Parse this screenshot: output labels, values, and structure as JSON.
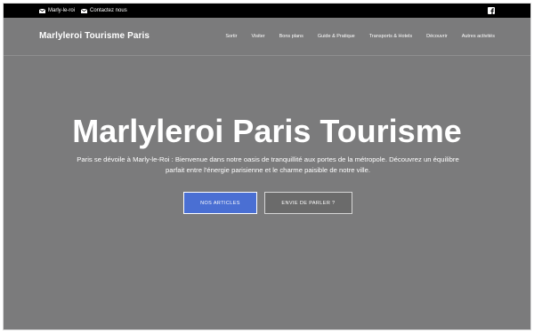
{
  "topbar": {
    "contacts": [
      {
        "label": "Marly-le-roi",
        "icon": "envelope-icon"
      },
      {
        "label": "Contactez nous",
        "icon": "envelope-icon"
      }
    ],
    "social_icon": "facebook-icon"
  },
  "navbar": {
    "brand": "Marlyleroi Tourisme Paris",
    "items": [
      {
        "label": "Sortir"
      },
      {
        "label": "Visiter"
      },
      {
        "label": "Bons plans"
      },
      {
        "label": "Guide & Pratique"
      },
      {
        "label": "Transports & Hotels"
      },
      {
        "label": "Découvrir"
      },
      {
        "label": "Autres activités"
      }
    ]
  },
  "hero": {
    "title": "Marlyleroi Paris Tourisme",
    "lead": "Paris se dévoile à Marly-le-Roi : Bienvenue dans notre oasis de tranquillité aux portes de la métropole. Découvrez un équilibre parfait entre l'énergie parisienne et le charme paisible de notre ville.",
    "primary_button": "NOS ARTICLES",
    "secondary_button": "ENVIE DE PARLER ?"
  },
  "colors": {
    "topbar": "#000000",
    "hero_bg": "#7b7b7c",
    "primary": "#4a6fd3"
  }
}
